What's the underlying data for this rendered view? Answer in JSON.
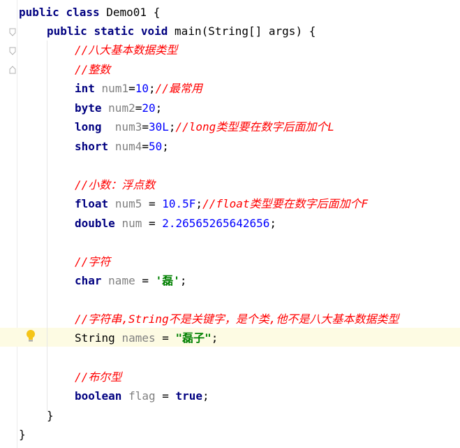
{
  "code": {
    "l1": {
      "kw1": "public",
      "kw2": "class",
      "name": "Demo01",
      "brace": "{"
    },
    "l2": {
      "kw1": "public",
      "kw2": "static",
      "kw3": "void",
      "sig": "main(String[] args)",
      "brace": "{"
    },
    "l3": {
      "comment": "//八大基本数据类型"
    },
    "l4": {
      "comment": "//整数"
    },
    "l5": {
      "type": "int",
      "var": "num1",
      "eq": "=",
      "num": "10",
      "semi": ";",
      "comment": "//最常用"
    },
    "l6": {
      "type": "byte",
      "var": "num2",
      "eq": "=",
      "num": "20",
      "semi": ";"
    },
    "l7": {
      "type": "long",
      "var": "num3",
      "eq": "=",
      "num": "30L",
      "semi": ";",
      "comment": "//long类型要在数字后面加个L"
    },
    "l8": {
      "type": "short",
      "var": "num4",
      "eq": "=",
      "num": "50",
      "semi": ";"
    },
    "l9": {
      "comment": "//小数：浮点数"
    },
    "l10": {
      "type": "float",
      "var": "num5",
      "eq": " = ",
      "num": "10.5F",
      "semi": ";",
      "comment": "//float类型要在数字后面加个F"
    },
    "l11": {
      "type": "double",
      "var": "num",
      "eq": " = ",
      "num": "2.26565265642656",
      "semi": ";"
    },
    "l12": {
      "comment": "//字符"
    },
    "l13": {
      "type": "char",
      "var": "name",
      "eq": " = ",
      "str": "'磊'",
      "semi": ";"
    },
    "l14": {
      "comment": "//字符串,String不是关键字，是个类,他不是八大基本数据类型"
    },
    "l15": {
      "type": "String",
      "var": "names",
      "eq": " = ",
      "str": "\"磊子\"",
      "semi": ";"
    },
    "l16": {
      "comment": "//布尔型"
    },
    "l17": {
      "type": "boolean",
      "var": "flag",
      "eq": " = ",
      "val": "true",
      "semi": ";"
    },
    "l18": {
      "brace": "}"
    },
    "l19": {
      "brace": "}"
    }
  },
  "colors": {
    "keyword": "#000080",
    "comment": "#ff0000",
    "number": "#0000ff",
    "string": "#008000",
    "variable": "#808080",
    "current_line": "#fdfbe3"
  },
  "icons": {
    "intention": "lightbulb-icon",
    "fold": "fold-marker-icon"
  }
}
